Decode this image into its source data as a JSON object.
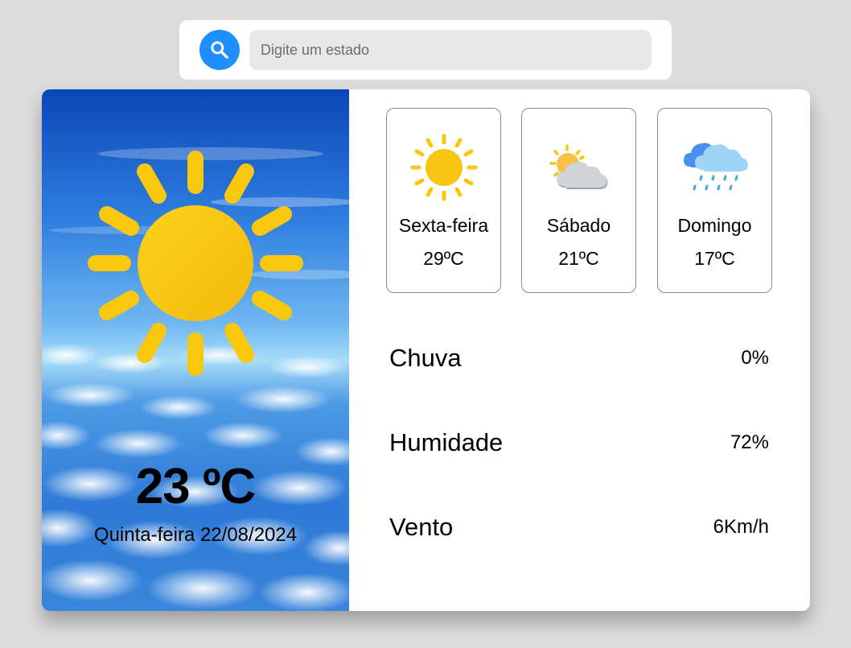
{
  "search": {
    "placeholder": "Digite um estado",
    "value": "",
    "button_icon": "search-icon",
    "button_color": "#1f8fff"
  },
  "today": {
    "temperature": "23 ºC",
    "date": "Quinta-feira 22/08/2024",
    "icon": "sun-icon",
    "background": "sky-with-clouds"
  },
  "forecast": [
    {
      "day": "Sexta-feira",
      "temp": "29ºC",
      "icon": "sun-icon"
    },
    {
      "day": "Sábado",
      "temp": "21ºC",
      "icon": "partly-cloudy-icon"
    },
    {
      "day": "Domingo",
      "temp": "17ºC",
      "icon": "rain-cloud-icon"
    }
  ],
  "stats": [
    {
      "label": "Chuva",
      "value": "0%"
    },
    {
      "label": "Humidade",
      "value": "72%"
    },
    {
      "label": "Vento",
      "value": "6Km/h"
    }
  ],
  "colors": {
    "page_background": "#dcdcdc",
    "card_background": "#ffffff",
    "sun": "#f9c80e",
    "accent": "#1f8fff"
  }
}
